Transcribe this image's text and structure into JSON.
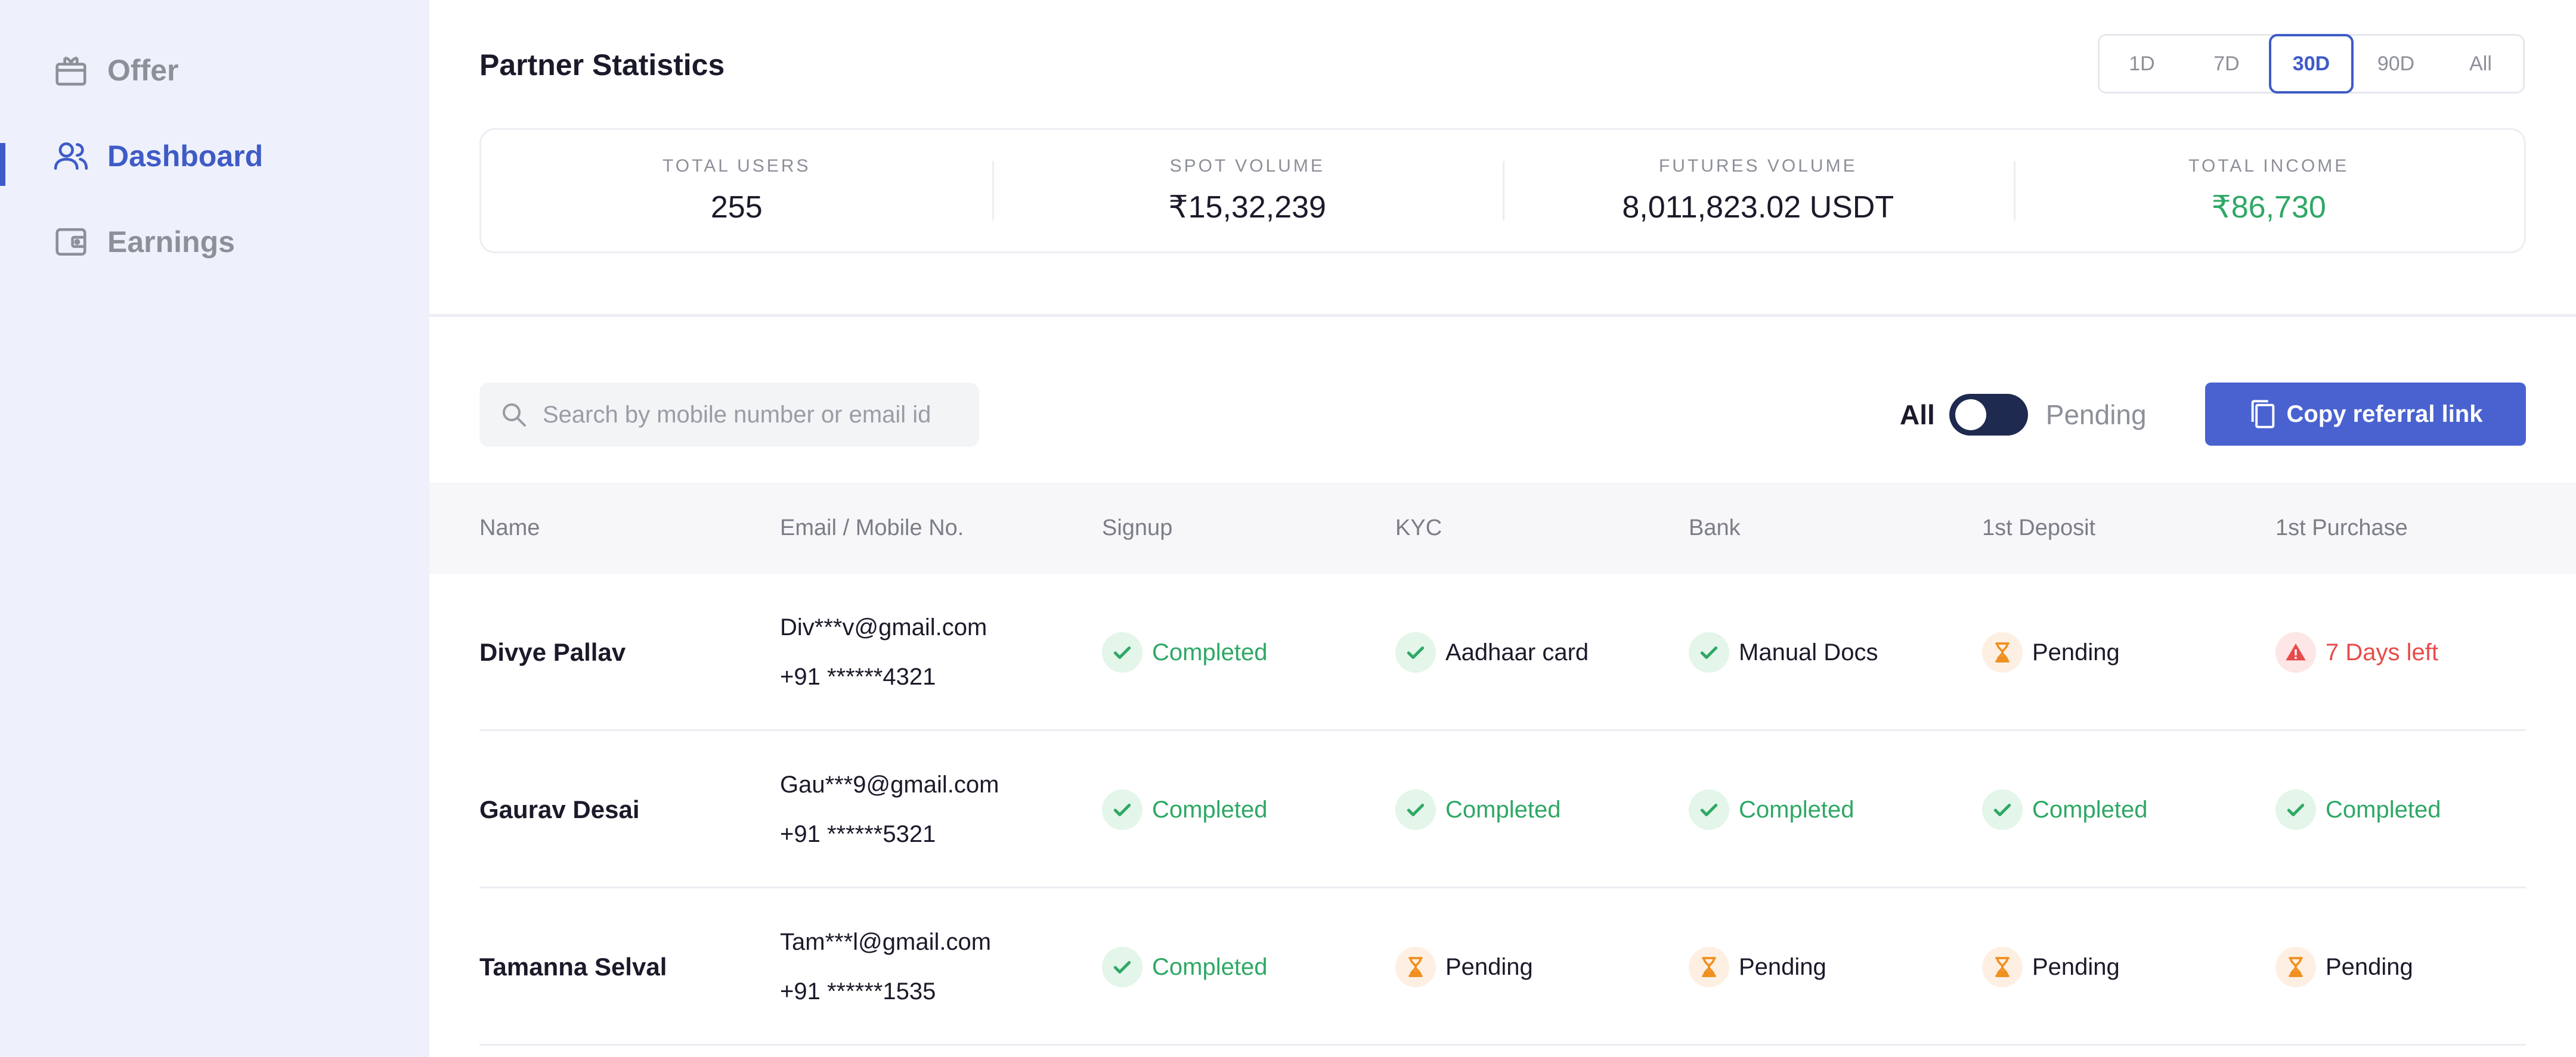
{
  "sidebar": {
    "items": [
      {
        "label": "Offer",
        "icon": "gift-icon"
      },
      {
        "label": "Dashboard",
        "icon": "users-icon",
        "active": true
      },
      {
        "label": "Earnings",
        "icon": "wallet-icon"
      }
    ]
  },
  "header": {
    "title": "Partner Statistics",
    "ranges": [
      "1D",
      "7D",
      "30D",
      "90D",
      "All"
    ],
    "selected_range": "30D"
  },
  "stats": [
    {
      "label": "TOTAL USERS",
      "value": "255"
    },
    {
      "label": "SPOT VOLUME",
      "value": "₹15,32,239"
    },
    {
      "label": "FUTURES VOLUME",
      "value": "8,011,823.02 USDT"
    },
    {
      "label": "TOTAL INCOME",
      "value": "₹86,730"
    }
  ],
  "toolbar": {
    "search_placeholder": "Search by mobile number or email id",
    "toggle_left": "All",
    "toggle_right": "Pending",
    "copy_label": "Copy referral link"
  },
  "table": {
    "columns": [
      "Name",
      "Email / Mobile No.",
      "Signup",
      "KYC",
      "Bank",
      "1st Deposit",
      "1st Purchase"
    ],
    "rows": [
      {
        "name": "Divye Pallav",
        "email": "Div***v@gmail.com",
        "mobile": "+91 ******4321",
        "signup": "Completed",
        "kyc": "Aadhaar card",
        "bank": "Manual Docs",
        "deposit": "Pending",
        "purchase": "7 Days left"
      },
      {
        "name": "Gaurav Desai",
        "email": "Gau***9@gmail.com",
        "mobile": "+91 ******5321",
        "signup": "Completed",
        "kyc": "Completed",
        "bank": "Completed",
        "deposit": "Completed",
        "purchase": "Completed"
      },
      {
        "name": "Tamanna Selval",
        "email": "Tam***l@gmail.com",
        "mobile": "+91 ******1535",
        "signup": "Completed",
        "kyc": "Pending",
        "bank": "Pending",
        "deposit": "Pending",
        "purchase": "Pending"
      }
    ]
  },
  "colors": {
    "accent": "#3f5bc7",
    "success": "#2fa865",
    "pending": "#f0901f",
    "danger": "#e84b4b",
    "sidebar_bg": "#eef1fb"
  }
}
